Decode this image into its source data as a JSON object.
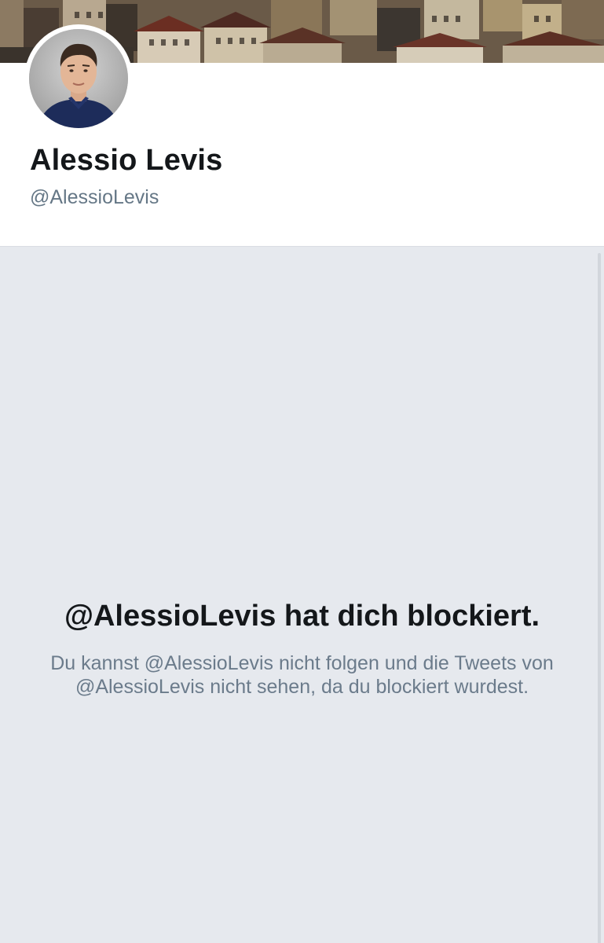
{
  "profile": {
    "display_name": "Alessio Levis",
    "handle": "@AlessioLevis"
  },
  "blocked": {
    "title": "@AlessioLevis hat dich blockiert.",
    "message": "Du kannst @AlessioLevis nicht folgen und die Tweets von @AlessioLevis nicht sehen, da du blockiert wurdest."
  },
  "colors": {
    "name_text": "#14171a",
    "secondary_text": "#657786",
    "blocked_background": "#e6e9ee"
  }
}
